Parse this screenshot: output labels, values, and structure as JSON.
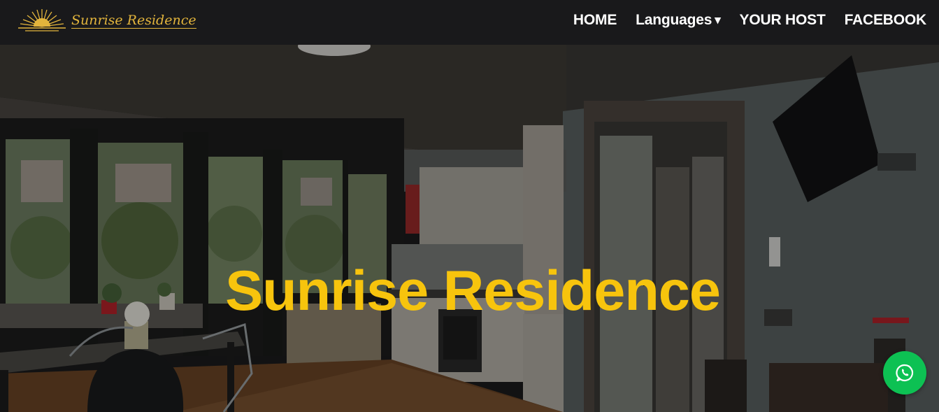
{
  "brand": {
    "logo_text": "Sunrise Residence",
    "logo_icon": "sunrise-icon",
    "logo_color": "#e3b53c"
  },
  "nav": {
    "items": [
      {
        "label": "HOME"
      },
      {
        "label": "Languages",
        "caret": "▾"
      },
      {
        "label": "YOUR HOST"
      },
      {
        "label": "FACEBOOK"
      }
    ]
  },
  "hero": {
    "title": "Sunrise Residence",
    "title_color": "#f7c40d",
    "image": "apartment-interior-photo"
  },
  "floating": {
    "whatsapp_icon": "whatsapp-icon",
    "color": "#0dc153"
  }
}
